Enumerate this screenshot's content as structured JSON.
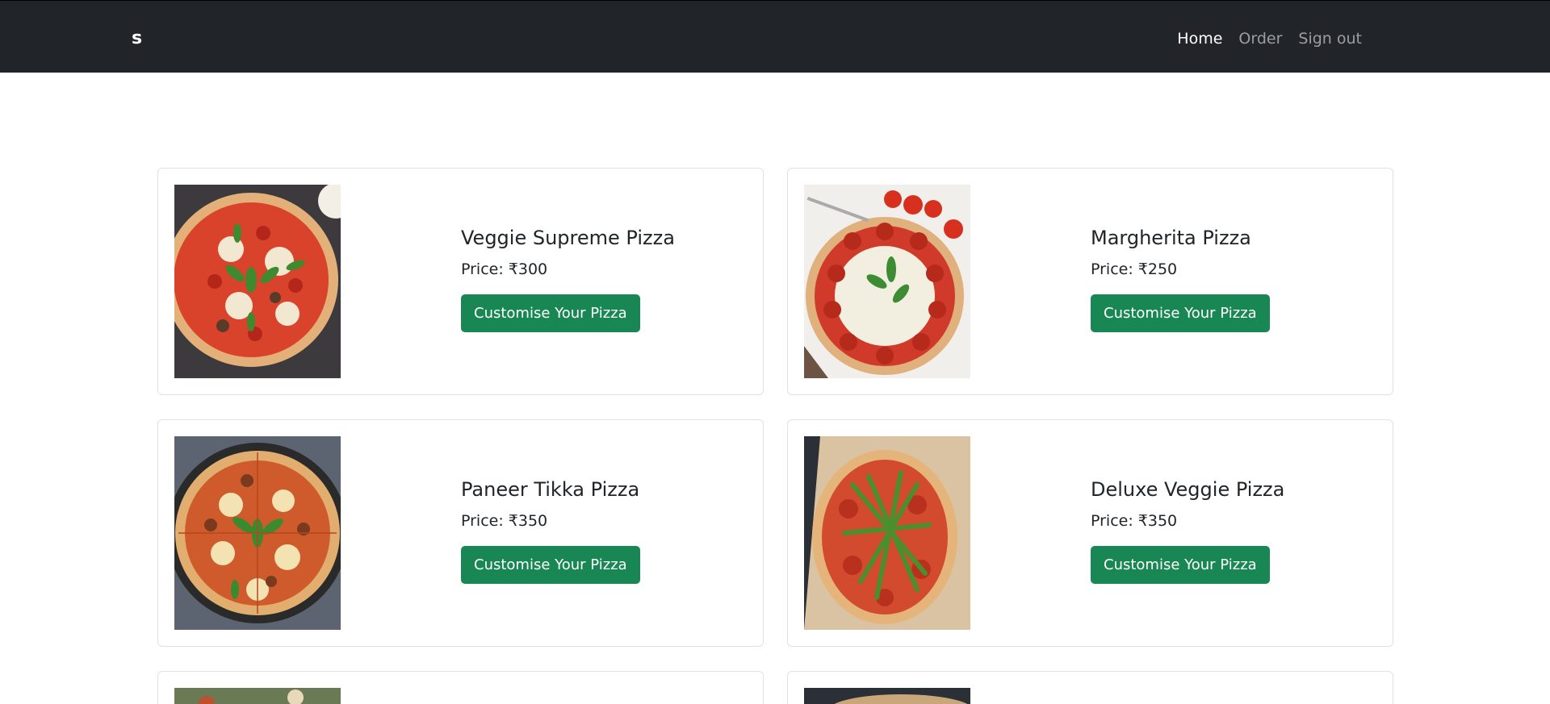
{
  "navbar": {
    "brand": "s",
    "links": [
      {
        "label": "Home",
        "active": true
      },
      {
        "label": "Order",
        "active": false
      },
      {
        "label": "Sign out",
        "active": false
      }
    ]
  },
  "products": [
    {
      "name": "Veggie Supreme Pizza",
      "price": "Price: ₹300",
      "button": "Customise Your Pizza",
      "image": "veggie-supreme-pizza-photo"
    },
    {
      "name": "Margherita Pizza",
      "price": "Price: ₹250",
      "button": "Customise Your Pizza",
      "image": "margherita-pizza-photo"
    },
    {
      "name": "Paneer Tikka Pizza",
      "price": "Price: ₹350",
      "button": "Customise Your Pizza",
      "image": "paneer-tikka-pizza-photo"
    },
    {
      "name": "Deluxe Veggie Pizza",
      "price": "Price: ₹350",
      "button": "Customise Your Pizza",
      "image": "deluxe-veggie-pizza-photo"
    }
  ],
  "colors": {
    "navbar_bg": "#212529",
    "button_bg": "#198754",
    "card_border": "#dee2e6"
  }
}
